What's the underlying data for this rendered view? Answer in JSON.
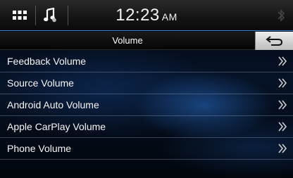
{
  "status_bar": {
    "apps_icon": "grid-icon",
    "music_icon": "music-note-icon",
    "time": "12:23",
    "ampm": "AM",
    "bluetooth_icon": "bluetooth-icon"
  },
  "title_bar": {
    "title": "Volume",
    "back_icon": "back-arrow-icon"
  },
  "menu": {
    "items": [
      {
        "label": "Feedback Volume"
      },
      {
        "label": "Source Volume"
      },
      {
        "label": "Android Auto Volume"
      },
      {
        "label": "Apple CarPlay Volume"
      },
      {
        "label": "Phone Volume"
      }
    ],
    "chevron_icon": "double-chevron-right-icon"
  },
  "colors": {
    "accent": "#3d7fd0",
    "background": "#061226",
    "text": "#ffffff"
  }
}
